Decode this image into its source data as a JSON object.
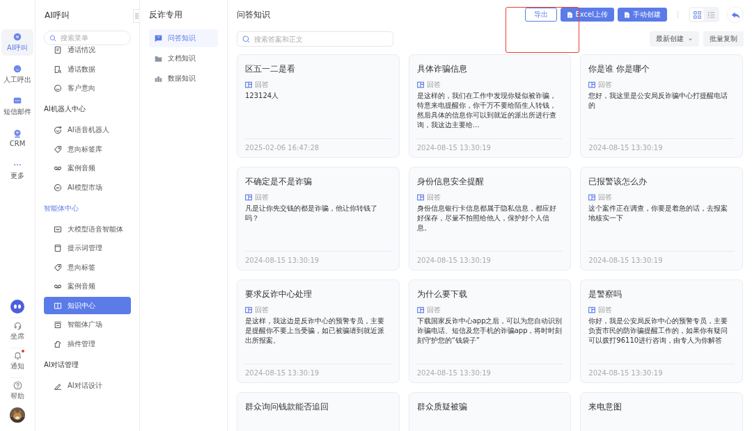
{
  "rail": {
    "items": [
      {
        "label": "AI呼叫",
        "selected": true
      },
      {
        "label": "人工呼出",
        "selected": false
      },
      {
        "label": "短信邮件",
        "selected": false
      },
      {
        "label": "CRM",
        "selected": false
      },
      {
        "label": "更多",
        "selected": false
      }
    ],
    "tools": [
      {
        "label": "坐席",
        "badge": false
      },
      {
        "label": "通知",
        "badge": true
      },
      {
        "label": "帮助",
        "badge": false
      }
    ]
  },
  "sidebar": {
    "title": "AI呼叫",
    "search": {
      "placeholder": "搜索菜单"
    },
    "groups": [
      {
        "items": [
          {
            "label": "通话情况",
            "selected": false
          },
          {
            "label": "通话数据",
            "selected": false
          },
          {
            "label": "客户意向",
            "selected": false
          }
        ]
      },
      {
        "heading": "AI机器人中心",
        "active": false,
        "items": [
          {
            "label": "AI语音机器人",
            "selected": false
          },
          {
            "label": "意向标签库",
            "selected": false
          },
          {
            "label": "案例音频",
            "selected": false
          },
          {
            "label": "AI模型市场",
            "selected": false
          }
        ]
      },
      {
        "heading": "智能体中心",
        "active": true,
        "items": [
          {
            "label": "大模型语音智能体",
            "selected": false
          },
          {
            "label": "提示词管理",
            "selected": false
          },
          {
            "label": "意向标签",
            "selected": false
          },
          {
            "label": "案例音频",
            "selected": false
          },
          {
            "label": "知识中心",
            "selected": true
          },
          {
            "label": "智能体广场",
            "selected": false
          },
          {
            "label": "插件管理",
            "selected": false
          }
        ]
      },
      {
        "heading": "AI对话管理",
        "active": false,
        "items": [
          {
            "label": "AI对话设计",
            "selected": false
          }
        ]
      }
    ]
  },
  "kb_nav": {
    "title": "反诈专用",
    "items": [
      {
        "label": "问答知识",
        "selected": true
      },
      {
        "label": "文档知识",
        "selected": false
      },
      {
        "label": "数据知识",
        "selected": false
      }
    ]
  },
  "main": {
    "title": "问答知识",
    "buttons": [
      {
        "label": "导出",
        "kind": "outline"
      },
      {
        "label": "Excel上传",
        "kind": "primary"
      },
      {
        "label": "手动创建",
        "kind": "primary"
      }
    ],
    "views": [
      {
        "selected": true
      },
      {
        "selected": false
      }
    ],
    "search": {
      "placeholder": "搜索答案和正文"
    },
    "sort": "最新创建",
    "batch": "批量复制",
    "cards": [
      {
        "title": "区五一二是看",
        "answer_label": "回答",
        "answer": "123124人",
        "date": "2025-02-06 16:47:28"
      },
      {
        "title": "具体诈骗信息",
        "answer_label": "回答",
        "answer": "是这样的，我们在工作中发现你疑似被诈骗，特意来电提醒你，你千万不要给陌生人转钱，然后具体的信息你可以到就近的派出所进行查询，我这边主要给…",
        "date": "2024-08-15 13:30:19"
      },
      {
        "title": "你是谁 你是哪个",
        "answer_label": "回答",
        "answer": "您好，我这里是公安局反诈骗中心打提醒电话的",
        "date": "2024-08-15 13:30:19"
      },
      {
        "title": "不确定是不是诈骗",
        "answer_label": "回答",
        "answer": "凡是让你先交钱的都是诈骗，他让你转钱了吗？",
        "date": "2024-08-15 13:30:19"
      },
      {
        "title": "身份信息安全提醒",
        "answer_label": "回答",
        "answer": "身份信息银行卡信息都属于隐私信息，都应好好保存，尽量不拍照给他人，保护好个人信息。",
        "date": "2024-08-15 13:30:19"
      },
      {
        "title": "已报警该怎么办",
        "answer_label": "回答",
        "answer": "这个案件正在调查，你要是着急的话，去报案地核实一下",
        "date": "2024-08-15 13:30:19"
      },
      {
        "title": "要求反诈中心处理",
        "answer_label": "回答",
        "answer": "是这样，我这边是反诈中心的预警专员，主要是提醒你不要上当受骗，如已被骗请到就近派出所报案。",
        "date": "2024-08-15 13:30:19"
      },
      {
        "title": "为什么要下载",
        "answer_label": "回答",
        "answer": "下载国家反诈中心app之后，可以为您自动识别诈骗电话、短信及您手机的诈骗app，将时时刻刻守护您的“钱袋子”",
        "date": "2024-08-15 13:30:19"
      },
      {
        "title": "是警察吗",
        "answer_label": "回答",
        "answer": "你好，我是公安局反诈中心的预警专员，主要负责市民的防诈骗提醒工作的，如果你有疑问可以拨打96110进行咨询，由专人为你解答",
        "date": "2024-08-15 13:30:19"
      },
      {
        "title": "群众询问钱款能否追回"
      },
      {
        "title": "群众质疑被骗"
      },
      {
        "title": "来电意图"
      }
    ]
  }
}
